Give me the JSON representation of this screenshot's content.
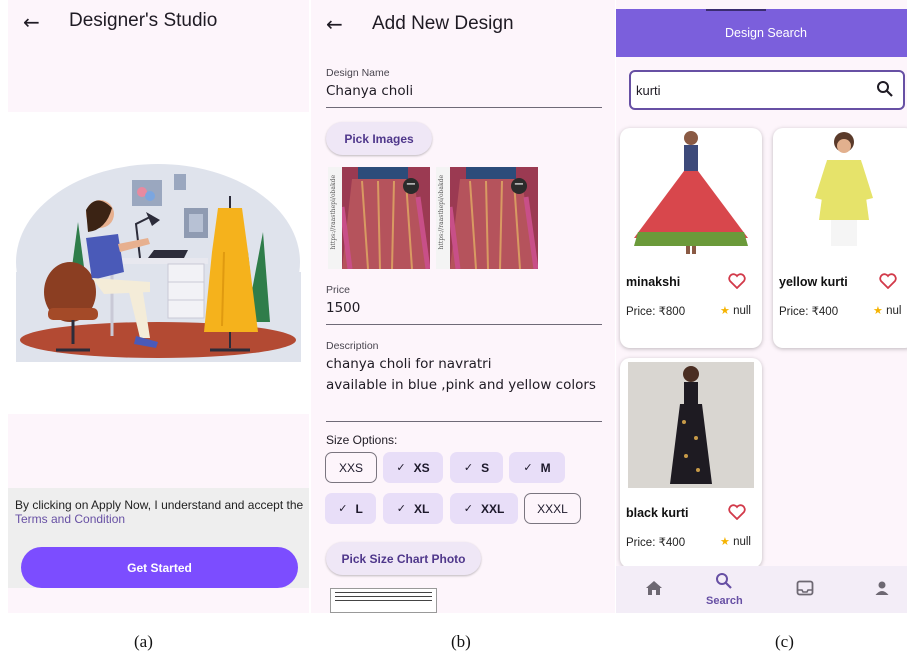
{
  "panel_a": {
    "title": "Designer's Studio",
    "terms_text": "By clicking on Apply Now, I understand and accept the",
    "terms_link": "Terms and Condition",
    "cta_label": "Get Started",
    "accent_color": "#7c4dff"
  },
  "panel_b": {
    "title": "Add New Design",
    "design_name_label": "Design Name",
    "design_name_value": "Chanya choli",
    "pick_images_label": "Pick Images",
    "image_watermark": "https://raasthepi/obakde",
    "price_label": "Price",
    "price_value": "1500",
    "description_label": "Description",
    "description_line1": "chanya choli for navratri",
    "description_line2": "available in blue ,pink and yellow colors",
    "size_options_label": "Size Options:",
    "sizes": [
      {
        "label": "XXS",
        "selected": false
      },
      {
        "label": "XS",
        "selected": true
      },
      {
        "label": "S",
        "selected": true
      },
      {
        "label": "M",
        "selected": true
      },
      {
        "label": "L",
        "selected": true
      },
      {
        "label": "XL",
        "selected": true
      },
      {
        "label": "XXL",
        "selected": true
      },
      {
        "label": "XXXL",
        "selected": false
      }
    ],
    "pick_size_chart_label": "Pick Size Chart Photo",
    "chip_selected_color": "#e8def8"
  },
  "panel_c": {
    "title": "Design Search",
    "search_value": "kurti",
    "products": [
      {
        "name": "minakshi",
        "price": "Price: ₹800",
        "rating": "null"
      },
      {
        "name": "yellow kurti",
        "price": "Price: ₹400",
        "rating": "nul"
      },
      {
        "name": "black kurti",
        "price": "Price: ₹400",
        "rating": "null"
      }
    ],
    "nav": {
      "active_label": "Search",
      "items": [
        "home-icon",
        "search-icon",
        "inbox-icon",
        "person-icon"
      ]
    },
    "header_color": "#7b5fdc"
  },
  "captions": [
    "(a)",
    "(b)",
    "(c)"
  ]
}
